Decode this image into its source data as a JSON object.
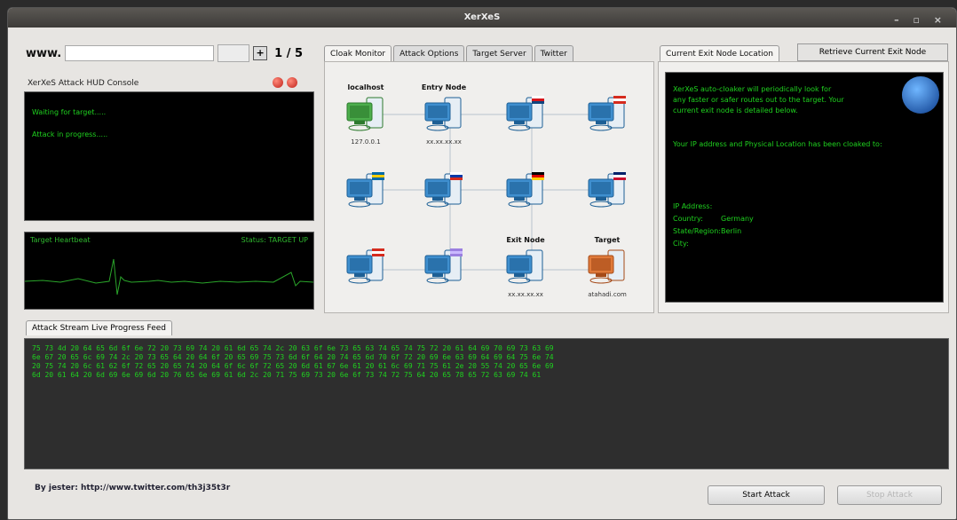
{
  "window": {
    "title": "XerXeS",
    "controls": "– ▫ ×"
  },
  "url_bar": {
    "prefix": "www.",
    "value": "",
    "go_label": "",
    "plus_label": "+",
    "counter": "1 / 5"
  },
  "hud": {
    "label": "XerXeS Attack HUD Console",
    "lines": [
      "Waiting for target.....",
      "Attack in progress....."
    ]
  },
  "heartbeat": {
    "title": "Target Heartbeat",
    "status": "Status: TARGET UP"
  },
  "tabs": [
    "Cloak Monitor",
    "Attack Options",
    "Target Server",
    "Twitter"
  ],
  "network": {
    "nodes": [
      {
        "label": "localhost",
        "sub": "127.0.0.1",
        "flag": "",
        "color": "green"
      },
      {
        "label": "Entry Node",
        "sub": "xx.xx.xx.xx",
        "flag": "",
        "color": "blue"
      },
      {
        "label": "",
        "sub": "",
        "flag": "czech",
        "color": "blue"
      },
      {
        "label": "",
        "sub": "",
        "flag": "canada",
        "color": "blue"
      },
      {
        "label": "",
        "sub": "",
        "flag": "sweden",
        "color": "blue"
      },
      {
        "label": "",
        "sub": "",
        "flag": "russia",
        "color": "blue"
      },
      {
        "label": "",
        "sub": "",
        "flag": "germany",
        "color": "blue"
      },
      {
        "label": "",
        "sub": "",
        "flag": "uk",
        "color": "blue"
      },
      {
        "label": "",
        "sub": "",
        "flag": "canada",
        "color": "blue"
      },
      {
        "label": "",
        "sub": "",
        "flag": "purple",
        "color": "blue"
      },
      {
        "label": "Exit Node",
        "sub": "xx.xx.xx.xx",
        "flag": "",
        "color": "blue"
      },
      {
        "label": "Target",
        "sub": "atahadi.com",
        "flag": "",
        "color": "orange"
      }
    ]
  },
  "exit_panel": {
    "tab_label": "Current Exit Node Location",
    "retrieve_label": "Retrieve Current Exit Node",
    "intro": [
      "XerXeS auto-cloaker will periodically look for",
      "any faster or safer routes out to the target. Your",
      "current exit node is detailed below."
    ],
    "cloaked_line": "Your IP address and Physical Location has been cloaked to:",
    "ip_label": "IP Address:",
    "country_label": "Country:",
    "country_value": "Germany",
    "state_label": "State/Region:",
    "state_value": "Berlin",
    "city_label": "City:"
  },
  "feed": {
    "tab_label": "Attack Stream Live Progress Feed",
    "lines": [
      "75 73 4d 20 64 65 6d 6f 6e 72 20 73 69 74 20 61 6d 65 74 2c 20 63 6f 6e 73 65 63 74 65 74 75 72 20 61 64 69 70 69 73 63 69",
      "6e 67 20 65 6c 69 74 2c 20 73 65 64 20 64 6f 20 65 69 75 73 6d 6f 64 20 74 65 6d 70 6f 72 20 69 6e 63 69 64 69 64 75 6e 74",
      "20 75 74 20 6c 61 62 6f 72 65 20 65 74 20 64 6f 6c 6f 72 65 20 6d 61 67 6e 61 20 61 6c 69 71 75 61 2e 20 55 74 20 65 6e 69",
      "6d 20 61 64 20 6d 69 6e 69 6d 20 76 65 6e 69 61 6d 2c 20 71 75 69 73 20 6e 6f 73 74 72 75 64 20 65 78 65 72 63 69 74 61"
    ]
  },
  "footer": {
    "byline": "By jester: http://www.twitter.com/th3j35t3r",
    "start_label": "Start Attack",
    "stop_label": "Stop Attack"
  },
  "colors": {
    "console_green": "#1fd21f",
    "feed_bg": "#2e2e2e"
  }
}
